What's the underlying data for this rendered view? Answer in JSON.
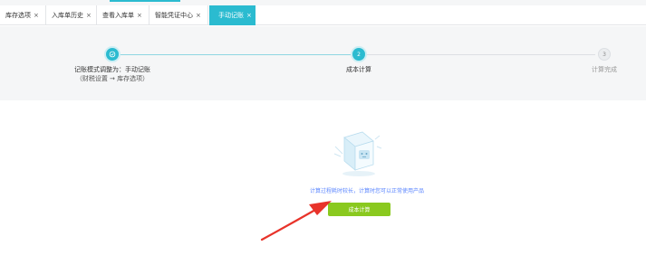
{
  "tabs": [
    {
      "label": "库存选项",
      "close": "×",
      "active": false
    },
    {
      "label": "入库单历史",
      "close": "×",
      "active": false
    },
    {
      "label": "查看入库单",
      "close": "×",
      "active": false
    },
    {
      "label": "智能凭证中心",
      "close": "×",
      "active": false
    },
    {
      "label": "手动记账",
      "close": "×",
      "active": true
    }
  ],
  "steps": [
    {
      "number": "1",
      "state": "done",
      "title": "记账模式调整为：手动记账",
      "subtitle": "（财税设置 → 库存选项）"
    },
    {
      "number": "2",
      "state": "active",
      "title": "成本计算",
      "subtitle": ""
    },
    {
      "number": "3",
      "state": "pending",
      "title": "计算完成",
      "subtitle": ""
    }
  ],
  "main": {
    "info_text": "计算过程耗时较长，计算时您可以正常使用产品",
    "calc_button_label": "成本计算"
  },
  "colors": {
    "accent": "#2bbbd0",
    "button": "#8ac91f",
    "info_text": "#5b86ff",
    "annotation_arrow": "#e8332a"
  },
  "icons": {
    "step1": "check-in-circle-icon",
    "illustration": "robot-computer-illustration",
    "annotation": "red-arrow-annotation"
  }
}
